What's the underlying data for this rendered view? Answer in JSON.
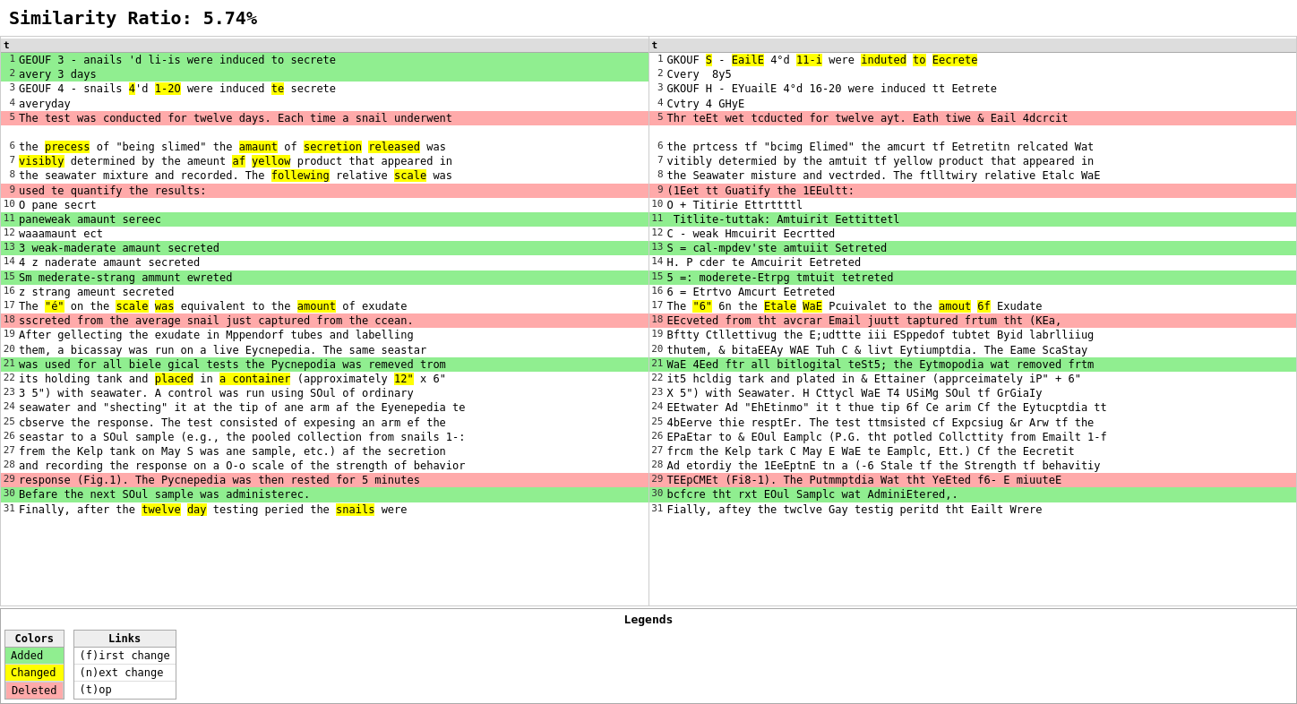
{
  "title": "Similarity Ratio: 5.74%",
  "left_panel_header": "t",
  "right_panel_header": "t",
  "left_lines": [
    {
      "num": 1,
      "text": "GEOUF 3 - anails 'd li-is were induced to secrete",
      "bg": "green"
    },
    {
      "num": 2,
      "text": "avery 3 days",
      "bg": "green"
    },
    {
      "num": 3,
      "text": "GEOUF 4 - snails 4'd 1-2O were induced te secrete",
      "bg": ""
    },
    {
      "num": 4,
      "text": "averyday",
      "bg": ""
    },
    {
      "num": 5,
      "text": "The test was conducted for twelve days. Each time a snail underwent",
      "bg": "red"
    },
    {
      "num": "",
      "text": "",
      "bg": ""
    },
    {
      "num": 6,
      "text": "the precess of \"being slimed\" the amaunt of secretion released was",
      "bg": ""
    },
    {
      "num": 7,
      "text": "visibly determined by the ameunt af yellow product that appeared in",
      "bg": ""
    },
    {
      "num": 8,
      "text": "the seawater mixture and recorded. The follewing relative scale was",
      "bg": ""
    },
    {
      "num": 9,
      "text": "used te quantify the results:",
      "bg": "red"
    },
    {
      "num": 10,
      "text": "O pane secrt",
      "bg": ""
    },
    {
      "num": 11,
      "text": "paneweak amaunt sereec",
      "bg": "green"
    },
    {
      "num": 12,
      "text": "waaamaunt ect",
      "bg": ""
    },
    {
      "num": 13,
      "text": "3 weak-maderate amaunt secreted",
      "bg": "green"
    },
    {
      "num": 14,
      "text": "4 z naderate amaunt secreted",
      "bg": ""
    },
    {
      "num": 15,
      "text": "Sm mederate-strang ammunt ewreted",
      "bg": "green"
    },
    {
      "num": 16,
      "text": "z strang ameunt secreted",
      "bg": ""
    },
    {
      "num": 17,
      "text": "The \"é\" on the scale was equivalent to the amount of exudate",
      "bg": ""
    },
    {
      "num": 18,
      "text": "sscreted from the average snail just captured from the ccean.",
      "bg": "red"
    },
    {
      "num": 19,
      "text": "After gellecting the exudate in Mppendorf tubes and labelling",
      "bg": ""
    },
    {
      "num": 20,
      "text": "them, a bicassay was run on a live Eycnepedia. The same seastar",
      "bg": ""
    },
    {
      "num": 21,
      "text": "was used for all biele gical tests the Pycnepodia was remeved trom",
      "bg": "green"
    },
    {
      "num": 22,
      "text": "its holding tank and placed in a container (approximately 12\" x 6\"",
      "bg": ""
    },
    {
      "num": 23,
      "text": "3 5\") with seawater. A control was run using SOul of ordinary",
      "bg": ""
    },
    {
      "num": 24,
      "text": "seawater and \"shecting\" it at the tip of ane arm af the Eyenepedia te",
      "bg": ""
    },
    {
      "num": 25,
      "text": "cbserve the response. The test consisted of expesing an arm ef the",
      "bg": ""
    },
    {
      "num": 26,
      "text": "seastar to a SOul sample (e.g., the pooled collection from snails 1-:",
      "bg": ""
    },
    {
      "num": 27,
      "text": "frem the Kelp tank on May S was ane sample, etc.) af the secretion",
      "bg": ""
    },
    {
      "num": 28,
      "text": "and recording the response on a O-o scale of the strength of behavior",
      "bg": ""
    },
    {
      "num": 29,
      "text": "response (Fig.1). The Pycnepedia was then rested for 5 minutes",
      "bg": "red"
    },
    {
      "num": 30,
      "text": "Befare the next SOul sample was administerec.",
      "bg": "green"
    },
    {
      "num": 31,
      "text": "Finally, after the twelve day testing peried the snails were",
      "bg": ""
    }
  ],
  "right_lines": [
    {
      "num": 1,
      "text": "GKOUF S - EailE 4°d 11-i were induted to Eecrete",
      "bg": ""
    },
    {
      "num": 2,
      "text": "Cvery  8y5",
      "bg": ""
    },
    {
      "num": 3,
      "text": "GKOUF H - EYuailE 4°d 16-20 were induced tt Eetrete",
      "bg": ""
    },
    {
      "num": 4,
      "text": "Cvtry 4 GHyE",
      "bg": ""
    },
    {
      "num": 5,
      "text": "Thr teEt wet tcducted for twelve ayt. Eath tiwe & Eail 4dcrcit",
      "bg": "red"
    },
    {
      "num": "",
      "text": "",
      "bg": ""
    },
    {
      "num": 6,
      "text": "the prtcess tf \"bcimg Elimed\" the amcurt tf Eetretitn relcated Wat",
      "bg": ""
    },
    {
      "num": 7,
      "text": "vitibly determied by the amtuit tf yellow product that appeared in",
      "bg": ""
    },
    {
      "num": 8,
      "text": "the Seawater misture and vectrded. The ftlltwiry relative Etalc WaE",
      "bg": ""
    },
    {
      "num": 9,
      "text": "(1Eet tt Guatify the 1EEultt:",
      "bg": "red"
    },
    {
      "num": 10,
      "text": "O + Titirie Ettrttttl",
      "bg": ""
    },
    {
      "num": 11,
      "text": " Titlite-tuttak: Amtuirit Eettittetl",
      "bg": "green"
    },
    {
      "num": 12,
      "text": "C - weak Hmcuirit Eecrtted",
      "bg": ""
    },
    {
      "num": 13,
      "text": "S = cal-mpdev'ste amtuiit Setreted",
      "bg": "green"
    },
    {
      "num": 14,
      "text": "H. P cder te Amcuirit Eetreted",
      "bg": ""
    },
    {
      "num": 15,
      "text": "5 =: moderete-Etrpg tmtuit tetreted",
      "bg": "green"
    },
    {
      "num": 16,
      "text": "6 = Etrtvo Amcurt Eetreted",
      "bg": ""
    },
    {
      "num": 17,
      "text": "The \"6\" 6n the Etale WaE Pcuivalet to the amout 6f Exudate",
      "bg": ""
    },
    {
      "num": 18,
      "text": "EEcveted from tht avcrar Email juutt taptured frtum tht (KEa,",
      "bg": "red"
    },
    {
      "num": 19,
      "text": "Bftty Ctllettivug the E;udttte iii ESppedof tubtet Byid labrlliiug",
      "bg": ""
    },
    {
      "num": 20,
      "text": "thutem, & bitaEEAy WAE Tuh C & livt Eytiumptdia. The Eame ScaStay",
      "bg": ""
    },
    {
      "num": 21,
      "text": "WaE 4Eed ftr all bitlogital teSt5; the Eytmopodia wat removed frtm",
      "bg": "green"
    },
    {
      "num": 22,
      "text": "it5 hcldig tark and plated in & Ettainer (apprceimately iP\" + 6\"",
      "bg": ""
    },
    {
      "num": 23,
      "text": "X 5\") with Seawater. H Cttycl WaE T4 USiMg SOul tf GrGiaIy",
      "bg": ""
    },
    {
      "num": 24,
      "text": "EEtwater Ad \"EhEtinmo\" it t thue tip 6f Ce arim Cf the Eytucptdia tt",
      "bg": ""
    },
    {
      "num": 25,
      "text": "4bEerve thie resptEr. The test ttmsisted cf Expcsiug &r Arw tf the",
      "bg": ""
    },
    {
      "num": 26,
      "text": "EPaEtar to & EOul Eamplc (P.G. tht potled Collcttity from Emailt 1-f",
      "bg": ""
    },
    {
      "num": 27,
      "text": "frcm the Kelp tark C May E WaE te Eamplc, Ett.) Cf the Eecretit",
      "bg": ""
    },
    {
      "num": 28,
      "text": "Ad etordiy the 1EeEptnE tn a (-6 Stale tf the Strength tf behavitiy",
      "bg": ""
    },
    {
      "num": 29,
      "text": "TEEpCMEt (Fi8-1). The Putmmptdia Wat tht YeEted f6- E miuuteE",
      "bg": "red"
    },
    {
      "num": 30,
      "text": "bcfcre tht rxt EOul Samplc wat AdminiEtered,.",
      "bg": "green"
    },
    {
      "num": 31,
      "text": "Fially, aftey the twclve Gay testig peritd tht Eailt Wrere",
      "bg": ""
    }
  ],
  "legends": {
    "title": "Legends",
    "colors_header": "Colors",
    "links_header": "Links",
    "items": [
      {
        "label": "Added",
        "type": "added"
      },
      {
        "label": "Changed",
        "type": "changed"
      },
      {
        "label": "Deleted",
        "type": "deleted"
      }
    ],
    "links": [
      {
        "label": "(f)irst change"
      },
      {
        "label": "(n)ext change"
      },
      {
        "label": "(t)op"
      }
    ]
  }
}
